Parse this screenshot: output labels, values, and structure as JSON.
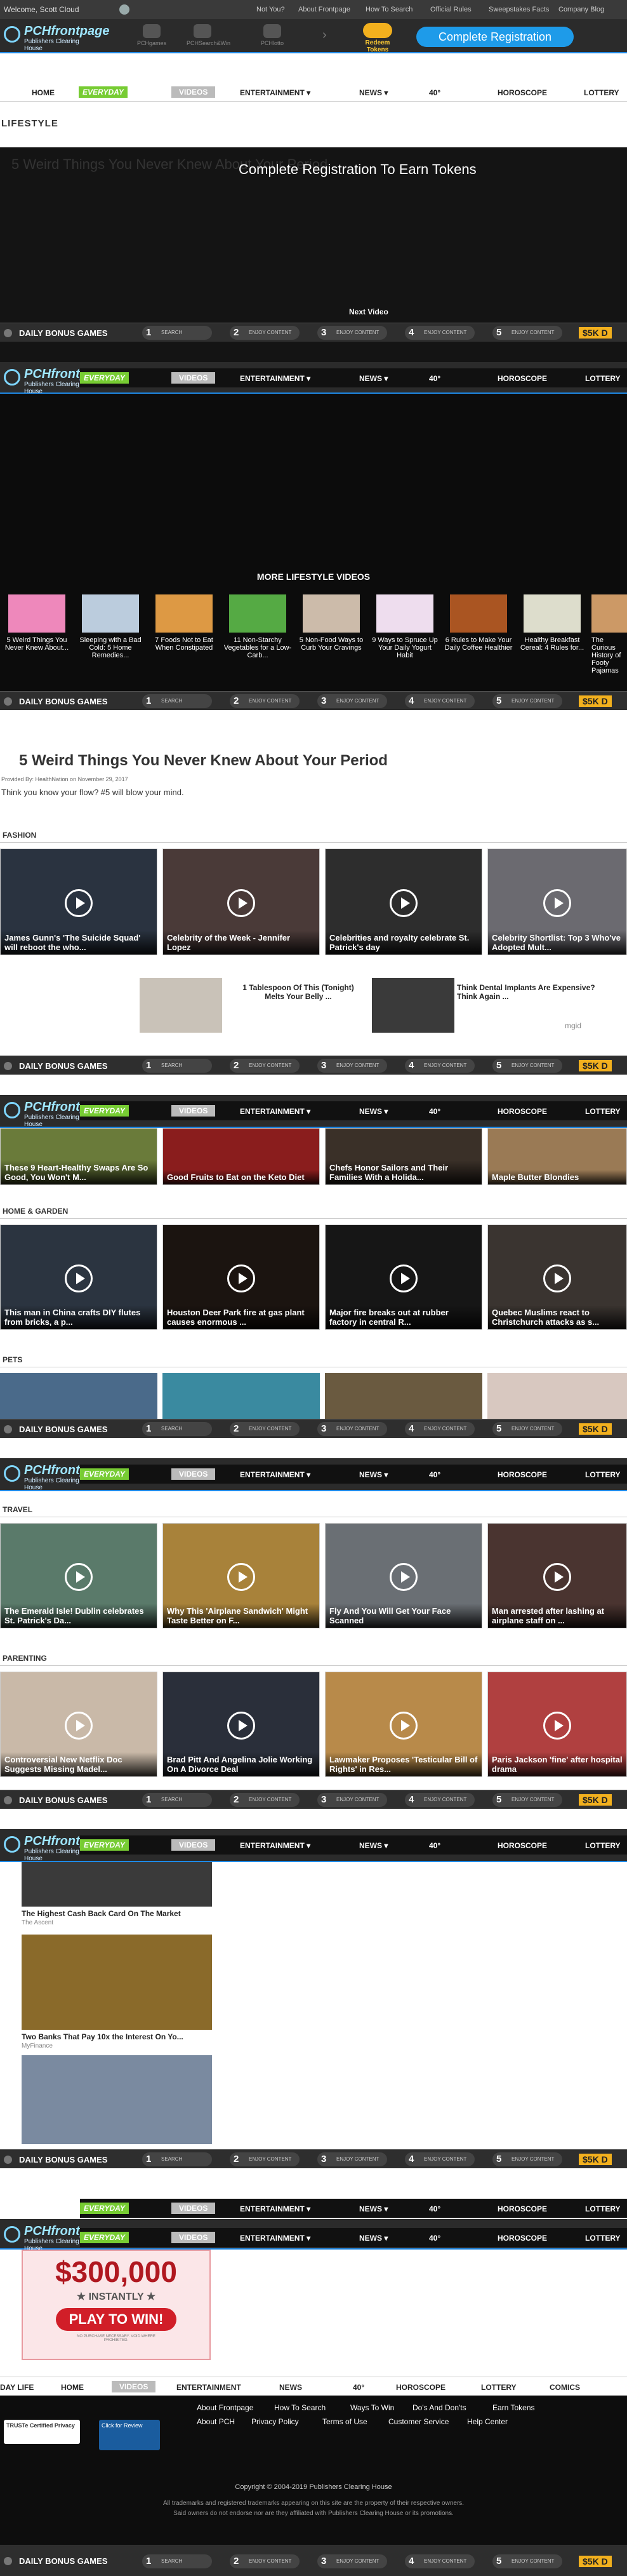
{
  "topbar": {
    "welcome": "Welcome, Scott Cloud",
    "links": [
      "Not You?",
      "About Frontpage",
      "How To Search",
      "Official Rules",
      "Sweepstakes Facts",
      "Company Blog"
    ]
  },
  "header": {
    "logo_main": "PCHfrontpage",
    "logo_sub": "Publishers Clearing House",
    "products": [
      "PCHgames",
      "PCHSearch&Win",
      "PCHlotto"
    ],
    "redeem": "Redeem Tokens",
    "cta": "Complete Registration"
  },
  "nav": {
    "items": [
      "HOME",
      "EVERYDAY",
      "VIDEOS",
      "ENTERTAINMENT ▾",
      "NEWS ▾",
      "40°",
      "HOROSCOPE",
      "LOTTERY"
    ]
  },
  "lifestyle": {
    "section": "LIFESTYLE",
    "video_title": "5 Weird Things You Never Knew About Your Period",
    "overlay": "Complete Registration To Earn Tokens",
    "next": "Next Video",
    "more": "MORE LIFESTYLE VIDEOS",
    "more_items": [
      "5 Weird Things You Never Knew About...",
      "Sleeping with a Bad Cold: 5 Home Remedies...",
      "7 Foods Not to Eat When Constipated",
      "11 Non-Starchy Vegetables for a Low-Carb...",
      "5 Non-Food Ways to Curb Your Cravings",
      "9 Ways to Spruce Up Your Daily Yogurt Habit",
      "6 Rules to Make Your Daily Coffee Healthier",
      "Healthy Breakfast Cereal: 4 Rules for...",
      "The Curious History of Footy Pajamas"
    ],
    "article_title": "5 Weird Things You Never Knew About Your Period",
    "byline": "Provided By: HealthNation on November 29, 2017",
    "teaser": "Think you know your flow? #5 will blow your mind."
  },
  "bonus": {
    "label": "DAILY BONUS GAMES",
    "steps": [
      {
        "n": "1",
        "t": "SEARCH"
      },
      {
        "n": "2",
        "t": "ENJOY CONTENT"
      },
      {
        "n": "3",
        "t": "ENJOY CONTENT"
      },
      {
        "n": "4",
        "t": "ENJOY CONTENT"
      },
      {
        "n": "5",
        "t": "ENJOY CONTENT"
      }
    ],
    "prize": "$5K D"
  },
  "fashion": {
    "section": "FASHION",
    "items": [
      "James Gunn's 'The Suicide Squad' will reboot the who...",
      "Celebrity of the Week - Jennifer Lopez",
      "Celebrities and royalty celebrate St. Patrick's day",
      "Celebrity Shortlist: Top 3 Who've Adopted Mult..."
    ]
  },
  "ads1": {
    "items": [
      "1 Tablespoon Of This (Tonight) Melts Your Belly ...",
      "Think Dental Implants Are Expensive? Think Again ..."
    ],
    "brand": "mgid"
  },
  "food": {
    "items": [
      "These 9 Heart-Healthy Swaps Are So Good, You Won't M...",
      "Good Fruits to Eat on the Keto Diet",
      "Chefs Honor Sailors and Their Families With a Holida...",
      "Maple Butter Blondies"
    ]
  },
  "home": {
    "section": "HOME & GARDEN",
    "items": [
      "This man in China crafts DIY flutes from bricks, a p...",
      "Houston Deer Park fire at gas plant causes enormous ...",
      "Major fire breaks out at rubber factory in central R...",
      "Quebec Muslims react to Christchurch attacks as s..."
    ]
  },
  "pets": {
    "section": "PETS"
  },
  "travel": {
    "section": "TRAVEL",
    "items": [
      "The Emerald Isle! Dublin celebrates St. Patrick's Da...",
      "Why This 'Airplane Sandwich' Might Taste Better on F...",
      "Fly And You Will Get Your Face Scanned",
      "Man arrested after lashing at airplane staff on ..."
    ]
  },
  "parenting": {
    "section": "PARENTING",
    "items": [
      "Controversial New Netflix Doc Suggests Missing Madel...",
      "Brad Pitt And Angelina Jolie Working On A Divorce Deal",
      "Lawmaker Proposes 'Testicular Bill of Rights' in Res...",
      "Paris Jackson 'fine' after hospital drama"
    ]
  },
  "ads2": {
    "items": [
      {
        "title": "The Highest Cash Back Card On The Market",
        "src": "The Ascent"
      },
      {
        "title": "Two Banks That Pay 10x the Interest On Yo...",
        "src": "MyFinance"
      }
    ]
  },
  "promo": {
    "amount": "$300,000",
    "instantly": "★ INSTANTLY ★",
    "play": "PLAY TO WIN!",
    "fine": "NO PURCHASE NECESSARY. VOID WHERE PROHIBITED."
  },
  "bottomnav": {
    "items": [
      "DAY LIFE",
      "HOME",
      "VIDEOS",
      "ENTERTAINMENT",
      "NEWS",
      "40°",
      "HOROSCOPE",
      "LOTTERY",
      "COMICS"
    ]
  },
  "footer": {
    "row1": [
      "About Frontpage",
      "How To Search",
      "Ways To Win",
      "Do's And Don'ts",
      "Earn Tokens"
    ],
    "row2": [
      "About PCH",
      "Privacy Policy",
      "Terms of Use",
      "Customer Service",
      "Help Center"
    ],
    "truste": "TRUSTe Certified Privacy",
    "bbb": "Click for Review",
    "copyright": "Copyright © 2004-2019 Publishers Clearing House",
    "trademark1": "All trademarks and registered trademarks appearing on this site are the property of their respective owners.",
    "trademark2": "Said owners do not endorse nor are they affiliated with Publishers Clearing House or its promotions."
  }
}
